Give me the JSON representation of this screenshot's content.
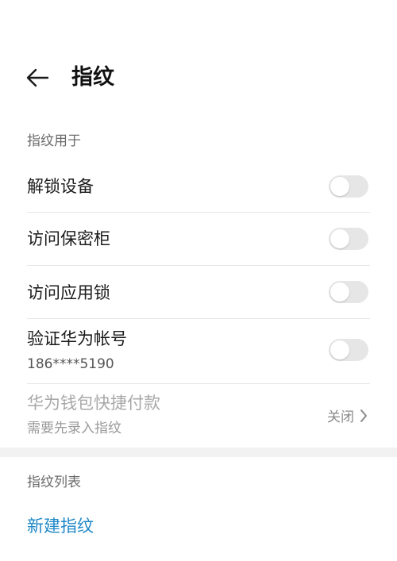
{
  "header": {
    "title": "指纹",
    "back_icon": "arrow-left-icon"
  },
  "usage_section": {
    "label": "指纹用于"
  },
  "items": [
    {
      "title": "解锁设备",
      "enabled": false
    },
    {
      "title": "访问保密柜",
      "enabled": false
    },
    {
      "title": "访问应用锁",
      "enabled": false
    },
    {
      "title": "验证华为帐号",
      "subtitle": "186****5190",
      "enabled": false
    },
    {
      "title": "华为钱包快捷付款",
      "subtitle": "需要先录入指纹",
      "status": "关闭",
      "disabled": true
    }
  ],
  "list_section": {
    "label": "指纹列表"
  },
  "new_fingerprint": {
    "label": "新建指纹"
  },
  "colors": {
    "accent": "#1e88c7",
    "toggle_off": "#e6e6e6",
    "disabled_text": "#a8a8a8"
  }
}
